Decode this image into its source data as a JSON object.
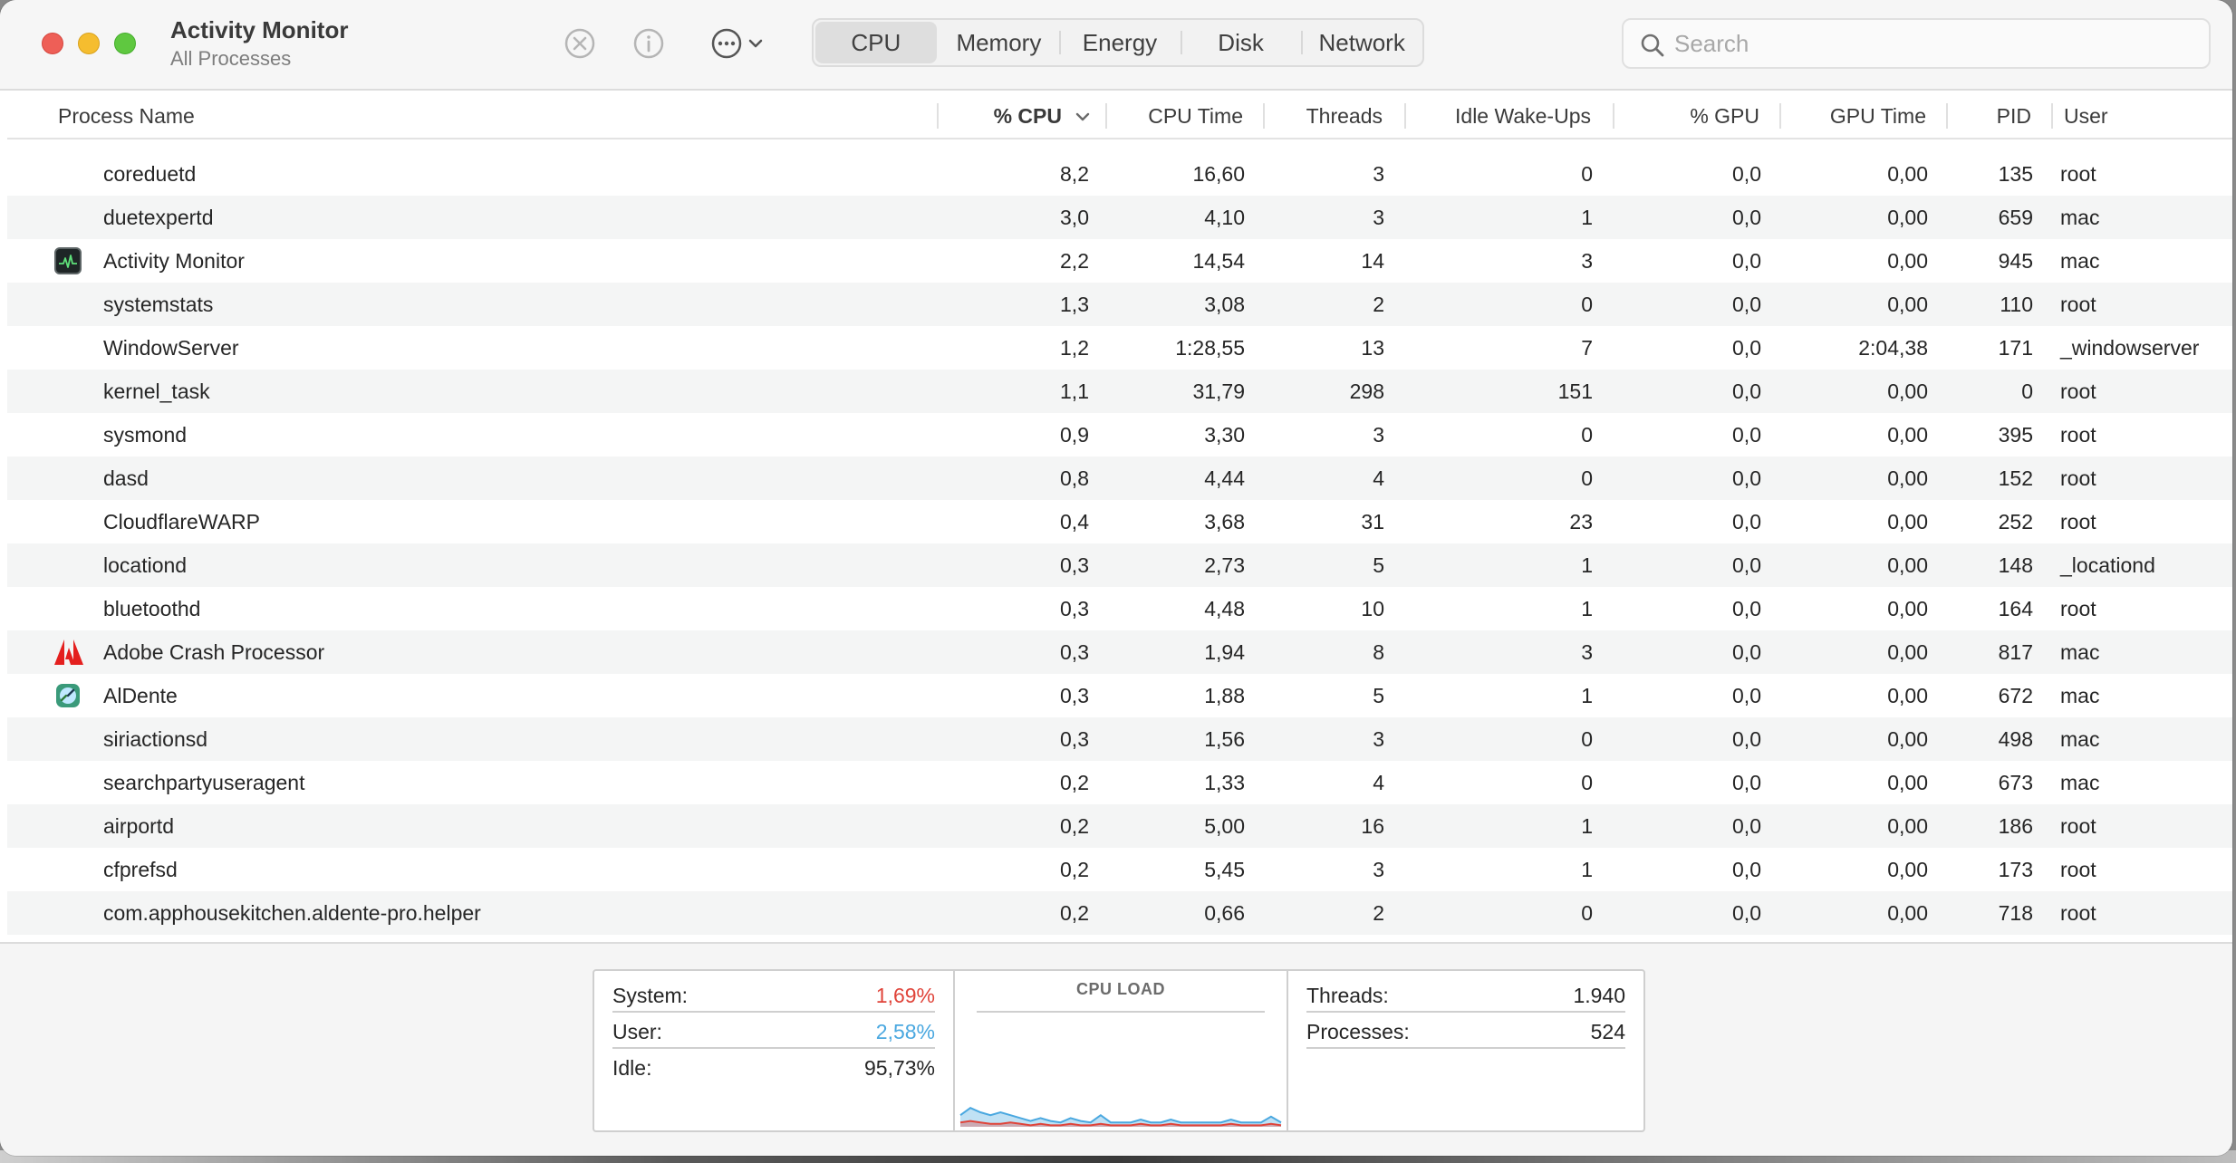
{
  "window": {
    "title": "Activity Monitor",
    "subtitle": "All Processes"
  },
  "toolbar": {
    "stop_icon": "x-circle-icon",
    "info_icon": "info-icon",
    "more_icon": "ellipsis-circle-icon"
  },
  "tabs": [
    {
      "label": "CPU",
      "active": true
    },
    {
      "label": "Memory",
      "active": false
    },
    {
      "label": "Energy",
      "active": false
    },
    {
      "label": "Disk",
      "active": false
    },
    {
      "label": "Network",
      "active": false
    }
  ],
  "search": {
    "placeholder": "Search",
    "value": ""
  },
  "columns": {
    "process_name": "Process Name",
    "cpu_pct": "% CPU",
    "cpu_time": "CPU Time",
    "threads": "Threads",
    "idle_wakeups": "Idle Wake-Ups",
    "gpu_pct": "% GPU",
    "gpu_time": "GPU Time",
    "pid": "PID",
    "user": "User"
  },
  "sort": {
    "column": "% CPU",
    "direction": "descending"
  },
  "processes": [
    {
      "name": "coreduetd",
      "icon": "",
      "cpu": "8,2",
      "cpu_time": "16,60",
      "threads": "3",
      "idle_wakeups": "0",
      "gpu": "0,0",
      "gpu_time": "0,00",
      "pid": "135",
      "user": "root"
    },
    {
      "name": "duetexpertd",
      "icon": "",
      "cpu": "3,0",
      "cpu_time": "4,10",
      "threads": "3",
      "idle_wakeups": "1",
      "gpu": "0,0",
      "gpu_time": "0,00",
      "pid": "659",
      "user": "mac"
    },
    {
      "name": "Activity Monitor",
      "icon": "activity-monitor-icon",
      "cpu": "2,2",
      "cpu_time": "14,54",
      "threads": "14",
      "idle_wakeups": "3",
      "gpu": "0,0",
      "gpu_time": "0,00",
      "pid": "945",
      "user": "mac"
    },
    {
      "name": "systemstats",
      "icon": "",
      "cpu": "1,3",
      "cpu_time": "3,08",
      "threads": "2",
      "idle_wakeups": "0",
      "gpu": "0,0",
      "gpu_time": "0,00",
      "pid": "110",
      "user": "root"
    },
    {
      "name": "WindowServer",
      "icon": "",
      "cpu": "1,2",
      "cpu_time": "1:28,55",
      "threads": "13",
      "idle_wakeups": "7",
      "gpu": "0,0",
      "gpu_time": "2:04,38",
      "pid": "171",
      "user": "_windowserver"
    },
    {
      "name": "kernel_task",
      "icon": "",
      "cpu": "1,1",
      "cpu_time": "31,79",
      "threads": "298",
      "idle_wakeups": "151",
      "gpu": "0,0",
      "gpu_time": "0,00",
      "pid": "0",
      "user": "root"
    },
    {
      "name": "sysmond",
      "icon": "",
      "cpu": "0,9",
      "cpu_time": "3,30",
      "threads": "3",
      "idle_wakeups": "0",
      "gpu": "0,0",
      "gpu_time": "0,00",
      "pid": "395",
      "user": "root"
    },
    {
      "name": "dasd",
      "icon": "",
      "cpu": "0,8",
      "cpu_time": "4,44",
      "threads": "4",
      "idle_wakeups": "0",
      "gpu": "0,0",
      "gpu_time": "0,00",
      "pid": "152",
      "user": "root"
    },
    {
      "name": "CloudflareWARP",
      "icon": "",
      "cpu": "0,4",
      "cpu_time": "3,68",
      "threads": "31",
      "idle_wakeups": "23",
      "gpu": "0,0",
      "gpu_time": "0,00",
      "pid": "252",
      "user": "root"
    },
    {
      "name": "locationd",
      "icon": "",
      "cpu": "0,3",
      "cpu_time": "2,73",
      "threads": "5",
      "idle_wakeups": "1",
      "gpu": "0,0",
      "gpu_time": "0,00",
      "pid": "148",
      "user": "_locationd"
    },
    {
      "name": "bluetoothd",
      "icon": "",
      "cpu": "0,3",
      "cpu_time": "4,48",
      "threads": "10",
      "idle_wakeups": "1",
      "gpu": "0,0",
      "gpu_time": "0,00",
      "pid": "164",
      "user": "root"
    },
    {
      "name": "Adobe Crash Processor",
      "icon": "adobe-icon",
      "cpu": "0,3",
      "cpu_time": "1,94",
      "threads": "8",
      "idle_wakeups": "3",
      "gpu": "0,0",
      "gpu_time": "0,00",
      "pid": "817",
      "user": "mac"
    },
    {
      "name": "AlDente",
      "icon": "aldente-icon",
      "cpu": "0,3",
      "cpu_time": "1,88",
      "threads": "5",
      "idle_wakeups": "1",
      "gpu": "0,0",
      "gpu_time": "0,00",
      "pid": "672",
      "user": "mac"
    },
    {
      "name": "siriactionsd",
      "icon": "",
      "cpu": "0,3",
      "cpu_time": "1,56",
      "threads": "3",
      "idle_wakeups": "0",
      "gpu": "0,0",
      "gpu_time": "0,00",
      "pid": "498",
      "user": "mac"
    },
    {
      "name": "searchpartyuseragent",
      "icon": "",
      "cpu": "0,2",
      "cpu_time": "1,33",
      "threads": "4",
      "idle_wakeups": "0",
      "gpu": "0,0",
      "gpu_time": "0,00",
      "pid": "673",
      "user": "mac"
    },
    {
      "name": "airportd",
      "icon": "",
      "cpu": "0,2",
      "cpu_time": "5,00",
      "threads": "16",
      "idle_wakeups": "1",
      "gpu": "0,0",
      "gpu_time": "0,00",
      "pid": "186",
      "user": "root"
    },
    {
      "name": "cfprefsd",
      "icon": "",
      "cpu": "0,2",
      "cpu_time": "5,45",
      "threads": "3",
      "idle_wakeups": "1",
      "gpu": "0,0",
      "gpu_time": "0,00",
      "pid": "173",
      "user": "root"
    },
    {
      "name": "com.apphousekitchen.aldente-pro.helper",
      "icon": "",
      "cpu": "0,2",
      "cpu_time": "0,66",
      "threads": "2",
      "idle_wakeups": "0",
      "gpu": "0,0",
      "gpu_time": "0,00",
      "pid": "718",
      "user": "root"
    }
  ],
  "summary": {
    "system_label": "System:",
    "system_value": "1,69%",
    "user_label": "User:",
    "user_value": "2,58%",
    "idle_label": "Idle:",
    "idle_value": "95,73%",
    "chart_title": "CPU LOAD",
    "threads_label": "Threads:",
    "threads_value": "1.940",
    "processes_label": "Processes:",
    "processes_value": "524"
  },
  "colors": {
    "system": "#e0443a",
    "user": "#4aa8e0",
    "close": "#ee5f57",
    "minimize": "#f5bd2f",
    "zoom": "#5fc840",
    "adobe": "#e4201f"
  },
  "cpu_load_history": {
    "system": [
      3,
      4,
      3,
      2,
      2,
      3,
      2,
      1,
      2,
      1,
      1,
      2,
      1,
      1,
      2,
      1,
      1,
      1,
      2,
      1,
      1,
      2,
      1,
      1,
      1,
      1,
      1,
      2,
      1,
      1,
      1,
      2,
      1
    ],
    "user": [
      5,
      9,
      7,
      6,
      8,
      5,
      4,
      3,
      4,
      3,
      2,
      4,
      3,
      2,
      6,
      2,
      2,
      2,
      3,
      2,
      2,
      3,
      2,
      2,
      2,
      2,
      2,
      3,
      2,
      2,
      2,
      5,
      2
    ]
  }
}
